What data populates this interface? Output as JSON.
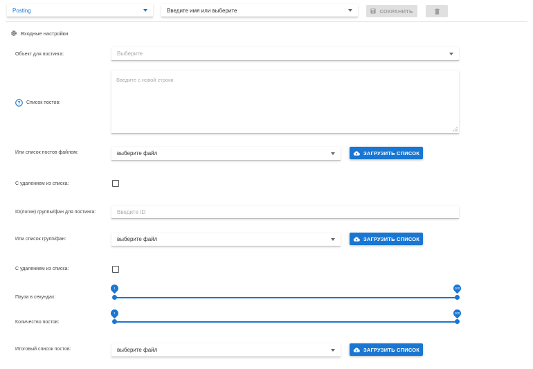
{
  "toolbar": {
    "mode_select": "Posting",
    "name_select_placeholder": "Введите имя или выберите",
    "save_label": "СОХРАНИТЬ",
    "delete_icon": "trash-icon"
  },
  "section": {
    "title": "Входные настройки",
    "icon": "gear-icon"
  },
  "form": {
    "object_label": "Объект для постинга:",
    "object_placeholder": "Выберите",
    "posts_label": "Список постов:",
    "posts_placeholder": "Введите с новой строки",
    "posts_file_label": "Или список постов файлом:",
    "posts_file_select": "выберите файл",
    "upload_label_1": "ЗАГРУЗИТЬ СПИСОК",
    "delete_from_list_label_1": "С удалением из списка:",
    "group_id_label": "ID(логин) группы/фан для постинга:",
    "group_id_placeholder": "Введите ID",
    "groups_list_label": "Или список групп/фан:",
    "groups_file_select": "выберите файл",
    "upload_label_2": "ЗАГРУЗИТЬ СПИСОК",
    "delete_from_list_label_2": "С удалением из списка:",
    "pause_label": "Пауза в секундах:",
    "pause_min": "1",
    "pause_max": "100",
    "count_label": "Количество постов:",
    "count_min": "1",
    "count_max": "100",
    "final_list_label": "Итоговый список постов:",
    "final_file_select": "выберите файл",
    "upload_label_3": "ЗАГРУЗИТЬ СПИСОК"
  },
  "colors": {
    "accent": "#1976d2",
    "disabled": "#e0e0e0"
  }
}
